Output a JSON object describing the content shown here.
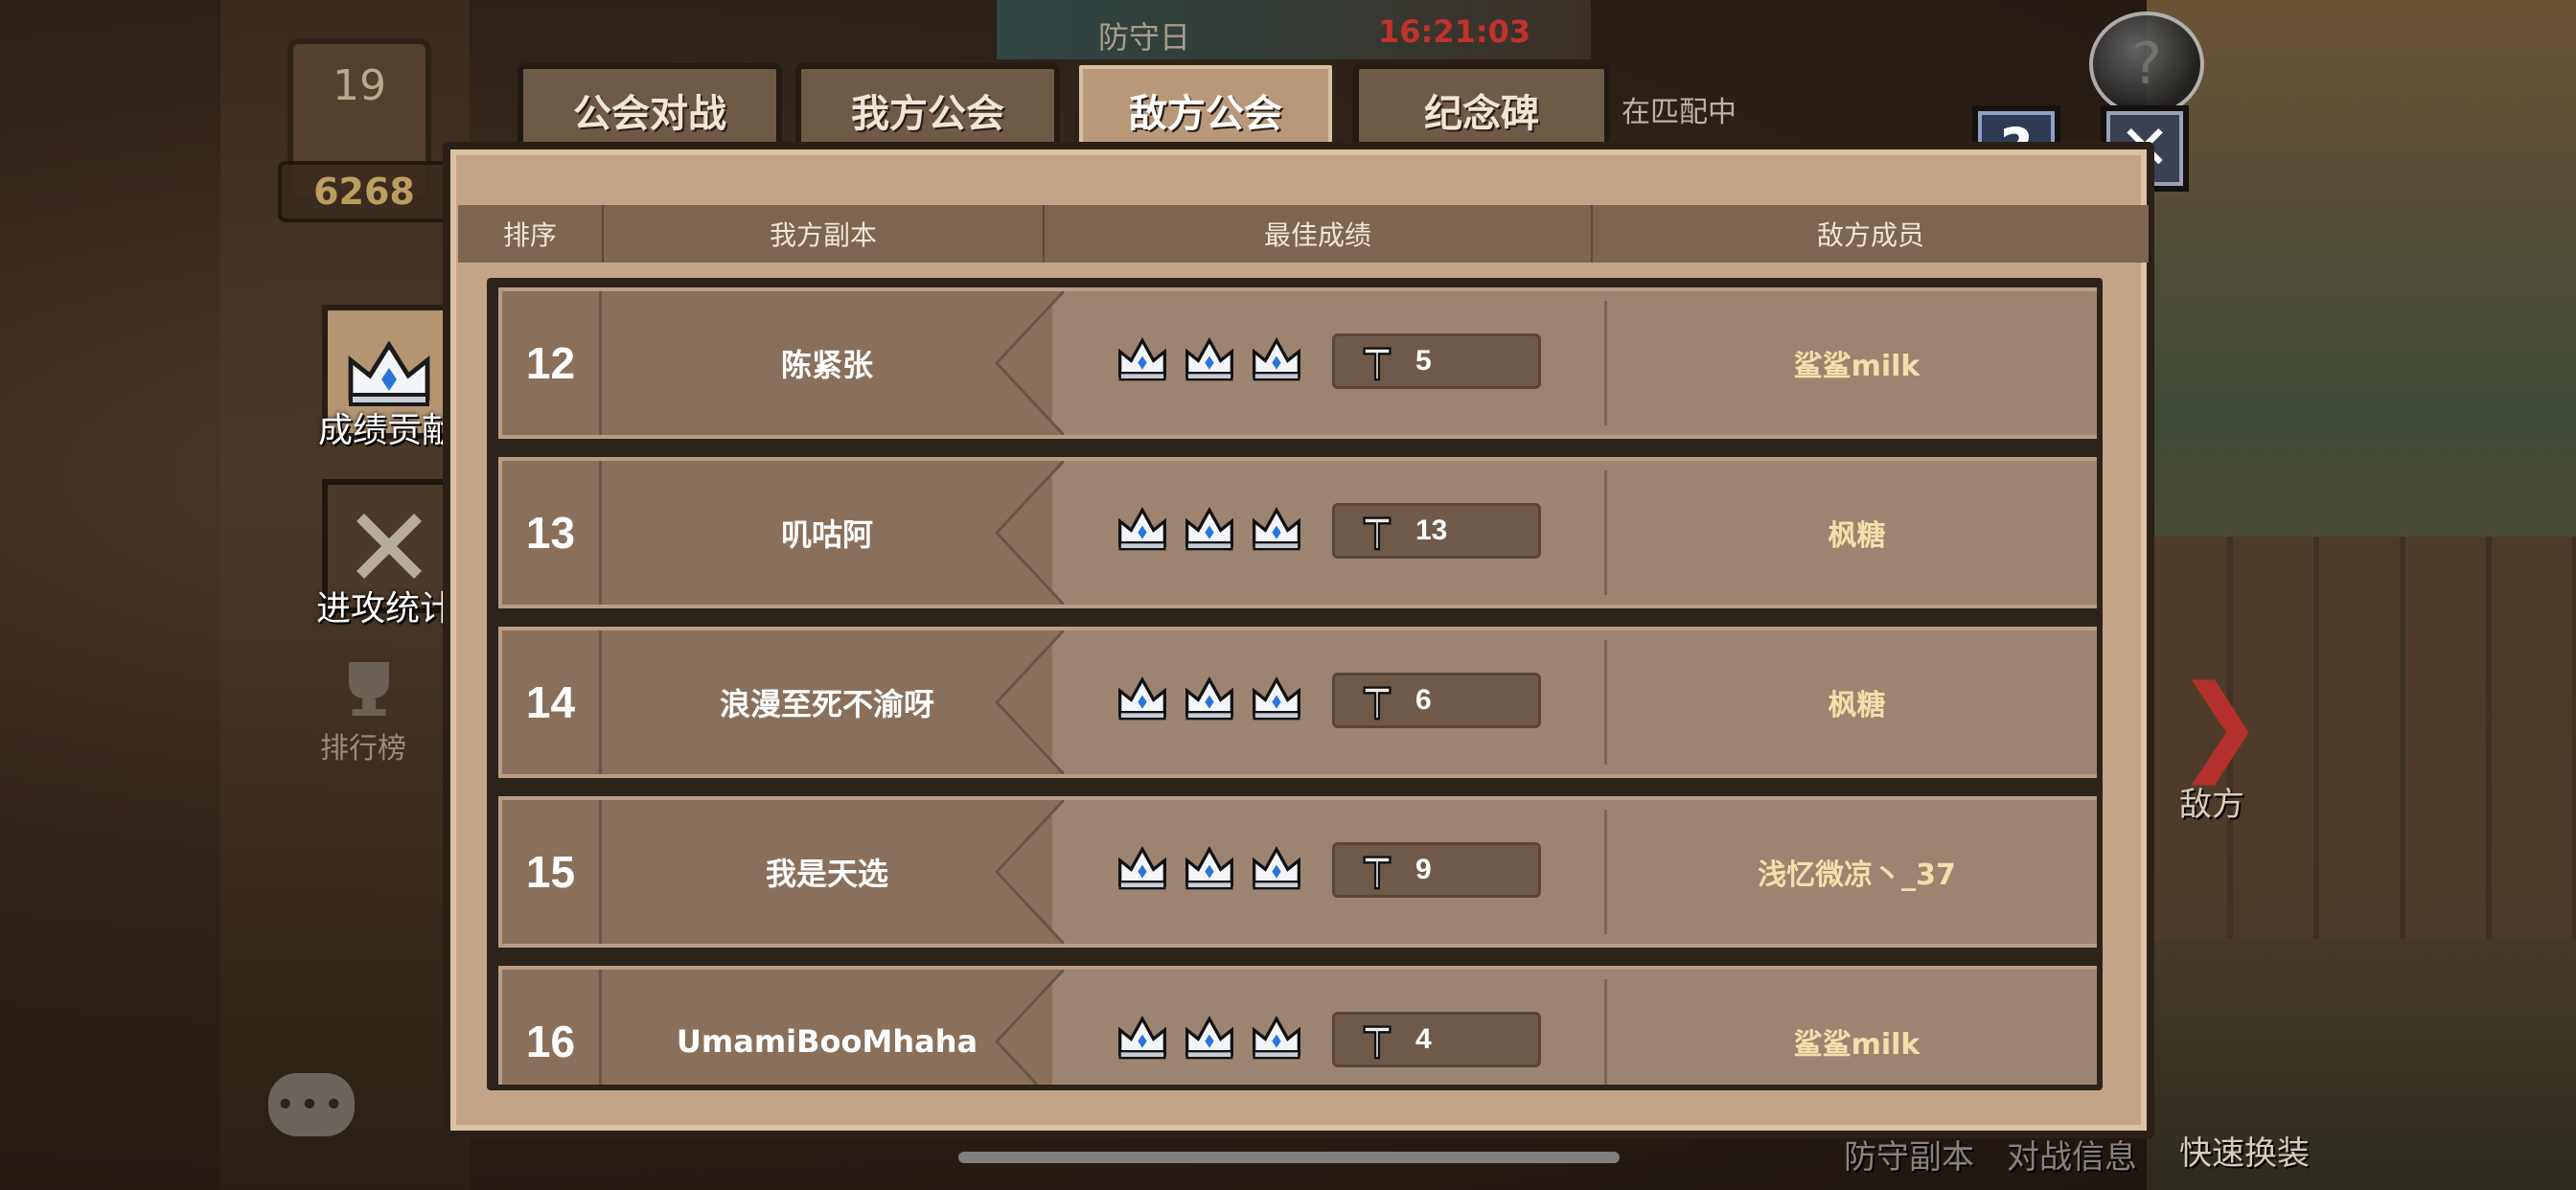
{
  "top_info": {
    "day_label": "防守日",
    "timer": "16:21:03",
    "matching": "在匹配中"
  },
  "hud": {
    "level": "19",
    "score": "6268"
  },
  "tabs": [
    {
      "label": "公会对战",
      "active": false
    },
    {
      "label": "我方公会",
      "active": false
    },
    {
      "label": "敌方公会",
      "active": true
    },
    {
      "label": "纪念碑",
      "active": false
    }
  ],
  "sidebar": {
    "items": [
      {
        "label": "成绩贡献",
        "active": true,
        "icon": "crown-icon"
      },
      {
        "label": "进攻统计",
        "active": false,
        "icon": "crossed-swords-icon"
      },
      {
        "label": "排行榜",
        "active": false,
        "icon": "trophy-icon"
      }
    ]
  },
  "table": {
    "headers": {
      "rank": "排序",
      "dungeon": "我方副本",
      "best": "最佳成绩",
      "member": "敌方成员"
    },
    "rows": [
      {
        "rank": "12",
        "dungeon": "陈紧张",
        "crowns": 3,
        "attempts": "5",
        "member": "鲨鲨milk"
      },
      {
        "rank": "13",
        "dungeon": "叽咕阿",
        "crowns": 3,
        "attempts": "13",
        "member": "枫糖"
      },
      {
        "rank": "14",
        "dungeon": "浪漫至死不渝呀",
        "crowns": 3,
        "attempts": "6",
        "member": "枫糖"
      },
      {
        "rank": "15",
        "dungeon": "我是天选",
        "crowns": 3,
        "attempts": "9",
        "member": "浅忆微凉丶_37"
      },
      {
        "rank": "16",
        "dungeon": "UmamiBooMhaha",
        "crowns": 3,
        "attempts": "4",
        "member": "鲨鲨milk"
      }
    ]
  },
  "right_panel": {
    "enemy_label": "敌方",
    "quick_swap": "快速换装",
    "defense_dungeon": "防守副本",
    "battle_info": "对战信息"
  },
  "buttons": {
    "help": "?",
    "close": "✕"
  },
  "colors": {
    "panel": "#c3a486",
    "row": "#9d8470",
    "member_text": "#f2dfab",
    "timer": "#c0332c"
  }
}
